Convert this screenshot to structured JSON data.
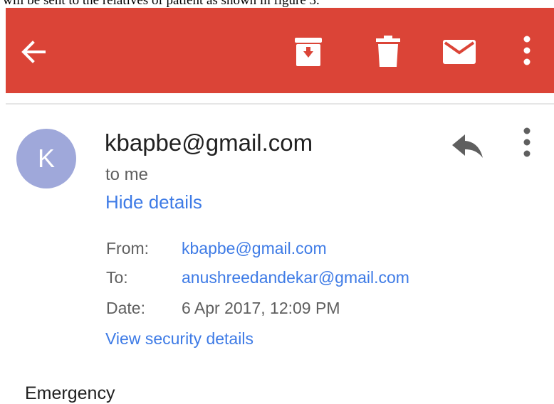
{
  "document": {
    "caption": "will be sent to the relatives of patient as shown in figure 3."
  },
  "colors": {
    "appbar": "#db4437",
    "avatar": "#9fa8da",
    "link": "#3e7be6"
  },
  "toolbar": {
    "icons": [
      "back-arrow-icon",
      "archive-icon",
      "delete-icon",
      "mark-unread-icon",
      "more-vert-icon"
    ]
  },
  "message": {
    "avatar_letter": "K",
    "sender": "kbapbe@gmail.com",
    "recipient_summary": "to me",
    "hide_details": "Hide details",
    "details": {
      "from_label": "From:",
      "from_value": "kbapbe@gmail.com",
      "to_label": "To:",
      "to_value": "anushreedandekar@gmail.com",
      "date_label": "Date:",
      "date_value": "6 Apr 2017, 12:09 PM"
    },
    "security_link": "View security details",
    "body": "Emergency"
  }
}
